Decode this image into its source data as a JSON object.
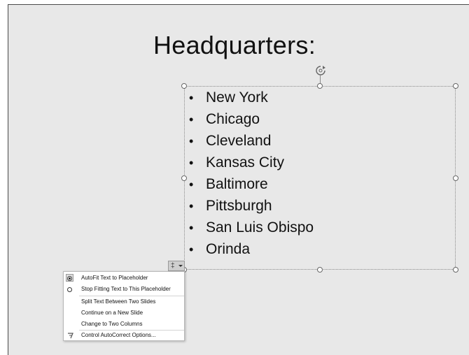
{
  "slide": {
    "title": "Headquarters:",
    "bullet_char": "•",
    "bullets": [
      "New York",
      "Chicago",
      "Cleveland",
      "Kansas City",
      "Baltimore",
      "Pittsburgh",
      "San Luis Obispo",
      "Orinda"
    ]
  },
  "autofit_button": {
    "icon": "autofit-options-icon",
    "glyph": "‡"
  },
  "autofit_menu": {
    "items": [
      {
        "label": "AutoFit Text to Placeholder",
        "type": "radio",
        "checked": true
      },
      {
        "label": "Stop Fitting Text to This Placeholder",
        "type": "radio",
        "checked": false
      },
      {
        "label": "Split Text Between Two Slides",
        "type": "command"
      },
      {
        "label": "Continue on a New Slide",
        "type": "command"
      },
      {
        "label": "Change to Two Columns",
        "type": "command"
      },
      {
        "label": "Control AutoCorrect Options...",
        "type": "command",
        "icon": "autocorrect-lightning-icon"
      }
    ]
  }
}
